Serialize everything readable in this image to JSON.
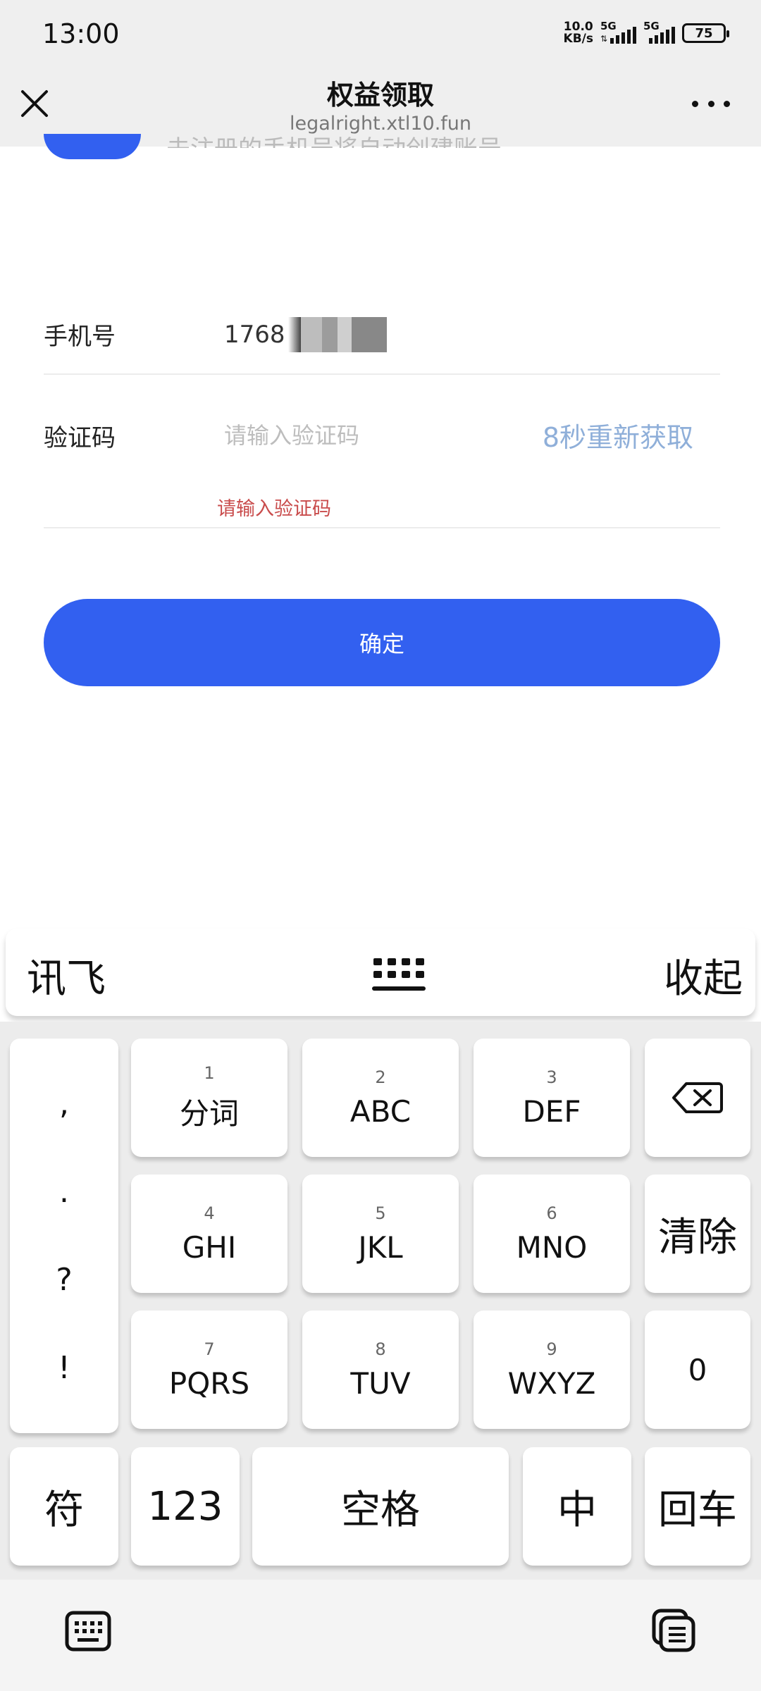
{
  "status_bar": {
    "time": "13:00",
    "net_speed_value": "10.0",
    "net_speed_unit": "KB/s",
    "signal1_label": "5G",
    "signal2_label": "5G",
    "battery": "75"
  },
  "browser": {
    "title": "权益领取",
    "url": "legalright.xtl10.fun",
    "close_icon": "close-icon",
    "more_icon": "more-icon"
  },
  "form": {
    "partial_text": "未注册的手机号将自动创建账号",
    "phone_label": "手机号",
    "phone_value": "1768",
    "code_label": "验证码",
    "code_placeholder": "请输入验证码",
    "code_value": "",
    "resend_label": "8秒重新获取",
    "error_message": "请输入验证码",
    "confirm_label": "确定",
    "accent_color": "#3260f0"
  },
  "keyboard": {
    "brand": "讯飞",
    "collapse_label": "收起",
    "switch_icon": "keyboard-layout-icon",
    "punctuation": [
      ",",
      ".",
      "?",
      "!"
    ],
    "keys": [
      {
        "num": "1",
        "label": "分词"
      },
      {
        "num": "2",
        "label": "ABC"
      },
      {
        "num": "3",
        "label": "DEF"
      },
      {
        "num": "4",
        "label": "GHI"
      },
      {
        "num": "5",
        "label": "JKL"
      },
      {
        "num": "6",
        "label": "MNO"
      },
      {
        "num": "7",
        "label": "PQRS"
      },
      {
        "num": "8",
        "label": "TUV"
      },
      {
        "num": "9",
        "label": "WXYZ"
      }
    ],
    "backspace_icon": "backspace-icon",
    "clear_label": "清除",
    "zero_label": "0",
    "symbol_label": "符",
    "numeric_label": "123",
    "space_label": "空格",
    "lang_label": "中",
    "enter_label": "回车"
  },
  "nav_bar": {
    "left_icon": "keyboard-icon",
    "right_icon": "clipboard-icon"
  }
}
